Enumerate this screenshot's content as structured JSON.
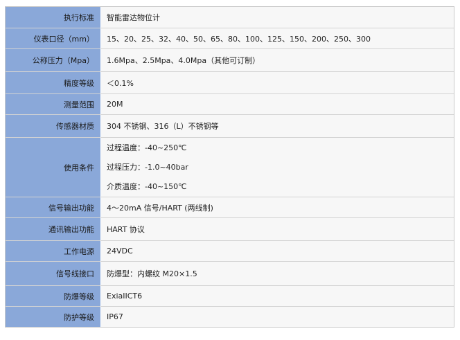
{
  "spec_table": {
    "rows": [
      {
        "label": "执行标准",
        "value": "智能雷达物位计"
      },
      {
        "label": "仪表口径（mm）",
        "value": "15、20、25、32、40、50、65、80、100、125、150、200、250、300"
      },
      {
        "label": "公称压力（Mpa）",
        "value": "1.6Mpa、2.5Mpa、4.0Mpa（其他可订制）"
      },
      {
        "label": "精度等级",
        "value": "＜0.1%"
      },
      {
        "label": "测量范围",
        "value": "20M"
      },
      {
        "label": "传感器材质",
        "value": "304 不锈钢、316（L）不锈钢等"
      },
      {
        "label": "使用条件",
        "lines": [
          "过程温度：-40~250℃",
          "过程压力：-1.0~40bar",
          "介质温度：-40~150℃"
        ]
      },
      {
        "label": "信号输出功能",
        "value": "4～20mA 信号/HART (两线制)"
      },
      {
        "label": "通讯输出功能",
        "value": "HART 协议"
      },
      {
        "label": "工作电源",
        "value": "24VDC"
      },
      {
        "label": "信号线接口",
        "value": "防爆型：内螺纹 M20×1.5"
      },
      {
        "label": "防爆等级",
        "value": "ExiaIICT6"
      },
      {
        "label": "防护等级",
        "value": "IP67"
      }
    ]
  },
  "colors": {
    "label_bg": "#8aa8d9",
    "value_bg": "#f7f7f7",
    "border": "#d3d3d3"
  }
}
